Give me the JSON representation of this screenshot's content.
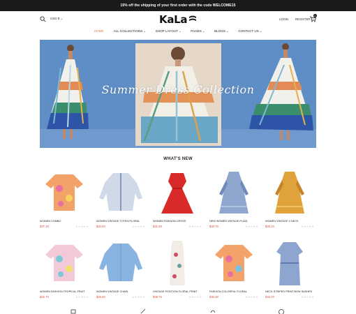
{
  "announcement": "15% off the shipping of your first order with the code WELCOME15",
  "header": {
    "currency": "USD $",
    "logo": "KaLa",
    "login": "LOGIN",
    "register": "REGISTER",
    "cart_count": "0"
  },
  "nav": {
    "items": [
      {
        "label": "HOME",
        "active": true,
        "dropdown": false
      },
      {
        "label": "ALL COLLECTIONS",
        "active": false,
        "dropdown": true
      },
      {
        "label": "SHOP LAYOUT",
        "active": false,
        "dropdown": true
      },
      {
        "label": "PAGES",
        "active": false,
        "dropdown": true
      },
      {
        "label": "BLOGS",
        "active": false,
        "dropdown": true
      },
      {
        "label": "CONTACT US",
        "active": false,
        "dropdown": true
      }
    ]
  },
  "hero": {
    "title": "Summer Dress Collection"
  },
  "section": {
    "title": "WHAT'S NEW"
  },
  "products": [
    {
      "name": "WOMEN COMBO",
      "price": "$27.16",
      "stars": "★★★★★"
    },
    {
      "name": "WOMEN VINTAGE TOTEM FLORAL",
      "price": "$34.94",
      "stars": "★★★★★"
    },
    {
      "name": "WOMEN FASHION CROSS",
      "price": "$31.68",
      "stars": "★★★★★"
    },
    {
      "name": "NEW WOMEN VINTAGE PLAID",
      "price": "$30.78",
      "stars": "★★★★★"
    },
    {
      "name": "WOMEN VINTAGE V NECK",
      "price": "$30.18",
      "stars": "★★★★★"
    },
    {
      "name": "WOMEN FASHION TROPICAL FRUIT",
      "price": "$32.70",
      "stars": "★★★★★"
    },
    {
      "name": "WOMEN VINTAGE CHAIN",
      "price": "$26.80",
      "stars": "★★★★★"
    },
    {
      "name": "VINTAGE POSITION FLORAL PRINT",
      "price": "$38.78",
      "stars": "★★★★★"
    },
    {
      "name": "FASHION COLORFUL FLORAL",
      "price": "$30.38",
      "stars": "★★★★★"
    },
    {
      "name": "NECK STRIPED PRINT BOW SASHES",
      "price": "$33.70",
      "stars": "★★★★★"
    }
  ],
  "colors": {
    "accent": "#e07a4b",
    "price": "#d9534f",
    "hero_bg": "#5f8ec7"
  }
}
